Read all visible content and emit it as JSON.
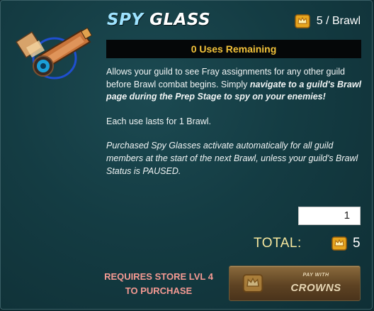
{
  "item": {
    "title_part1": "SPY",
    "title_part2": "GLASS",
    "icon": "spyglass-icon"
  },
  "cost": {
    "icon": "crown-icon",
    "label": "5 / Brawl"
  },
  "uses": {
    "label": "0 Uses Remaining"
  },
  "description": {
    "line1_text": "Allows your guild to see Fray assignments for any other guild before Brawl combat begins. Simply ",
    "line1_bold": "navigate to a guild's Brawl page during the Prep Stage to spy on your enemies!",
    "line2": "Each use lasts for 1 Brawl.",
    "line3": "Purchased Spy Glasses activate automatically for all guild members at the start of the next Brawl, unless your guild's Brawl Status is PAUSED."
  },
  "quantity": {
    "value": "1"
  },
  "total": {
    "label": "TOTAL:",
    "icon": "crown-icon",
    "value": "5"
  },
  "requirement": {
    "line1": "REQUIRES STORE LVL 4",
    "line2": "TO PURCHASE"
  },
  "pay_button": {
    "small_label": "PAY WITH",
    "big_label": "CROWNS",
    "icon": "crown-icon"
  },
  "colors": {
    "background": "#143c43",
    "uses_text": "#f2c23a",
    "requirement_text": "#f59a93",
    "total_label": "#f6e79e",
    "button_bg": "#6b4d28"
  }
}
